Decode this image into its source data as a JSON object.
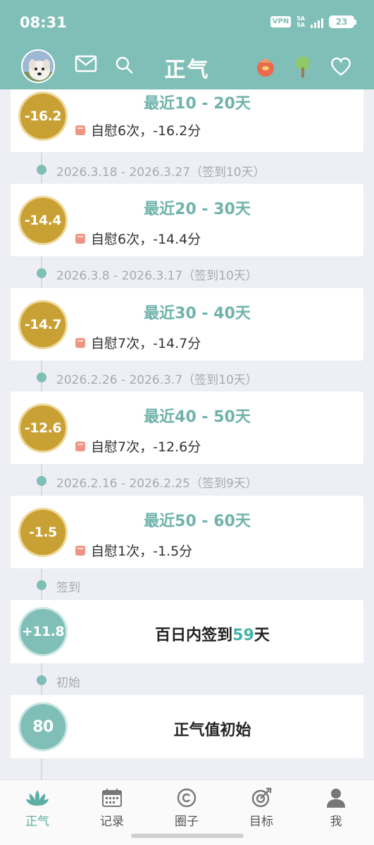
{
  "status_bar": {
    "time": "08:31",
    "vpn": "VPN",
    "network_top": "5A",
    "network_bottom": "5A",
    "battery": "23"
  },
  "header": {
    "title": "正气",
    "colors": {
      "primary": "#7fbfb7",
      "accent_gold": "#c9a033"
    }
  },
  "top_card": {
    "score": "-16.2",
    "title": "最近10 - 20天",
    "detail": "自慰6次，-16.2分"
  },
  "timeline": [
    {
      "range": "2026.3.18 - 2026.3.27（签到10天）",
      "score": "-14.4",
      "title": "最近20 - 30天",
      "detail": "自慰6次，-14.4分"
    },
    {
      "range": "2026.3.8 - 2026.3.17（签到10天）",
      "score": "-14.7",
      "title": "最近30 - 40天",
      "detail": "自慰7次，-14.7分"
    },
    {
      "range": "2026.2.26 - 2026.3.7（签到10天）",
      "score": "-12.6",
      "title": "最近40 - 50天",
      "detail": "自慰7次，-12.6分"
    },
    {
      "range": "2026.2.16 - 2026.2.25（签到9天）",
      "score": "-1.5",
      "title": "最近50 - 60天",
      "detail": "自慰1次，-1.5分"
    }
  ],
  "checkin": {
    "label": "签到",
    "score": "+11.8",
    "text_before": "百日内签到",
    "days": "59",
    "text_after": "天"
  },
  "initial": {
    "label": "初始",
    "score": "80",
    "text": "正气值初始"
  },
  "bottom_nav": {
    "items": [
      {
        "label": "正气",
        "icon": "lotus-icon",
        "active": true
      },
      {
        "label": "记录",
        "icon": "calendar-icon",
        "active": false
      },
      {
        "label": "圈子",
        "icon": "circle-icon",
        "active": false
      },
      {
        "label": "目标",
        "icon": "target-icon",
        "active": false
      },
      {
        "label": "我",
        "icon": "user-icon",
        "active": false
      }
    ]
  }
}
